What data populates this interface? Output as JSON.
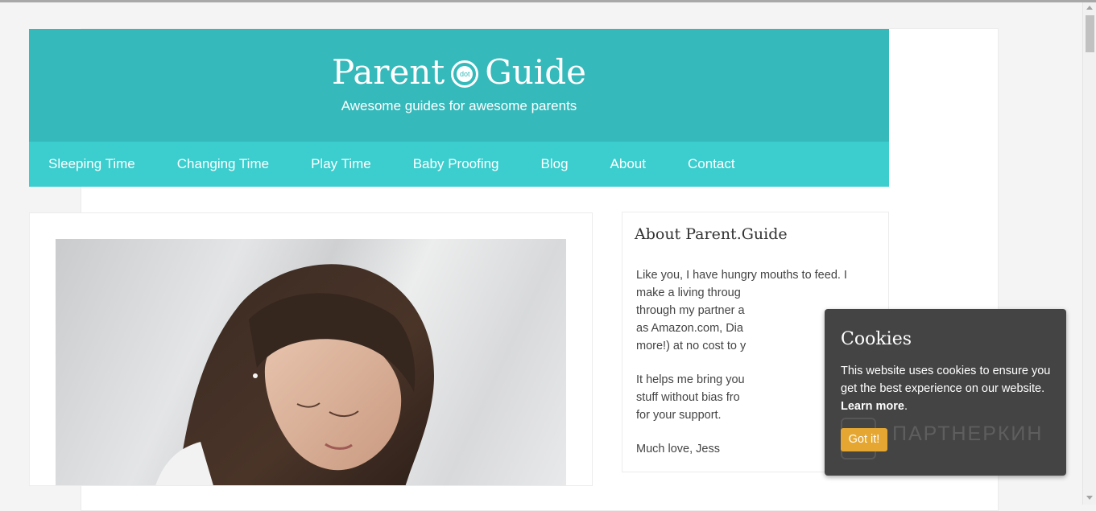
{
  "site": {
    "logo_left": "Parent",
    "logo_dot": "dot",
    "logo_right": "Guide",
    "tagline": "Awesome guides for awesome parents"
  },
  "nav": {
    "items": [
      {
        "label": "Sleeping Time"
      },
      {
        "label": "Changing Time"
      },
      {
        "label": "Play Time"
      },
      {
        "label": "Baby Proofing"
      },
      {
        "label": "Blog"
      },
      {
        "label": "About"
      },
      {
        "label": "Contact"
      }
    ]
  },
  "sidebar": {
    "title": "About Parent.Guide",
    "paragraphs": [
      {
        "lines": [
          "Like you, I have hungry mouths to feed. I",
          "make a living throug",
          "through my partner a",
          "as Amazon.com, Dia",
          "more!) at no cost to y"
        ]
      },
      {
        "lines": [
          "It helps me bring you",
          "stuff without bias fro",
          "for your support."
        ]
      },
      {
        "lines": [
          "Much love, Jess"
        ]
      }
    ]
  },
  "cookie": {
    "title": "Cookies",
    "text": "This website uses cookies to ensure you get the best experience on our website.",
    "link": "Learn more",
    "period": ".",
    "button": "Got it!",
    "watermark": "ПАРТНЕРКИН"
  },
  "colors": {
    "header_bg": "#35b9bb",
    "nav_bg": "#3ccdce",
    "cookie_bg": "#444444",
    "cookie_button": "#e5a731"
  }
}
